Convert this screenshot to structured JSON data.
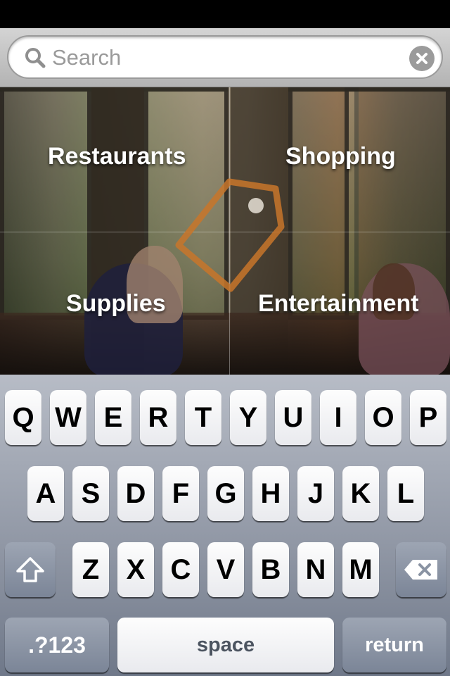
{
  "search": {
    "placeholder": "Search",
    "value": ""
  },
  "categories": [
    "Restaurants",
    "Shopping",
    "Supplies",
    "Entertainment"
  ],
  "keyboard": {
    "row1": [
      "Q",
      "W",
      "E",
      "R",
      "T",
      "Y",
      "U",
      "I",
      "O",
      "P"
    ],
    "row2": [
      "A",
      "S",
      "D",
      "F",
      "G",
      "H",
      "J",
      "K",
      "L"
    ],
    "row3": [
      "Z",
      "X",
      "C",
      "V",
      "B",
      "N",
      "M"
    ],
    "numbers_label": ".?123",
    "space_label": "space",
    "return_label": "return"
  },
  "icons": {
    "search": "search-icon",
    "clear": "clear-icon",
    "shift": "shift-icon",
    "delete": "backspace-icon",
    "logo": "price-tag-icon"
  },
  "colors": {
    "tag_accent": "#c8752a",
    "key_dark": "#8c95a5"
  }
}
